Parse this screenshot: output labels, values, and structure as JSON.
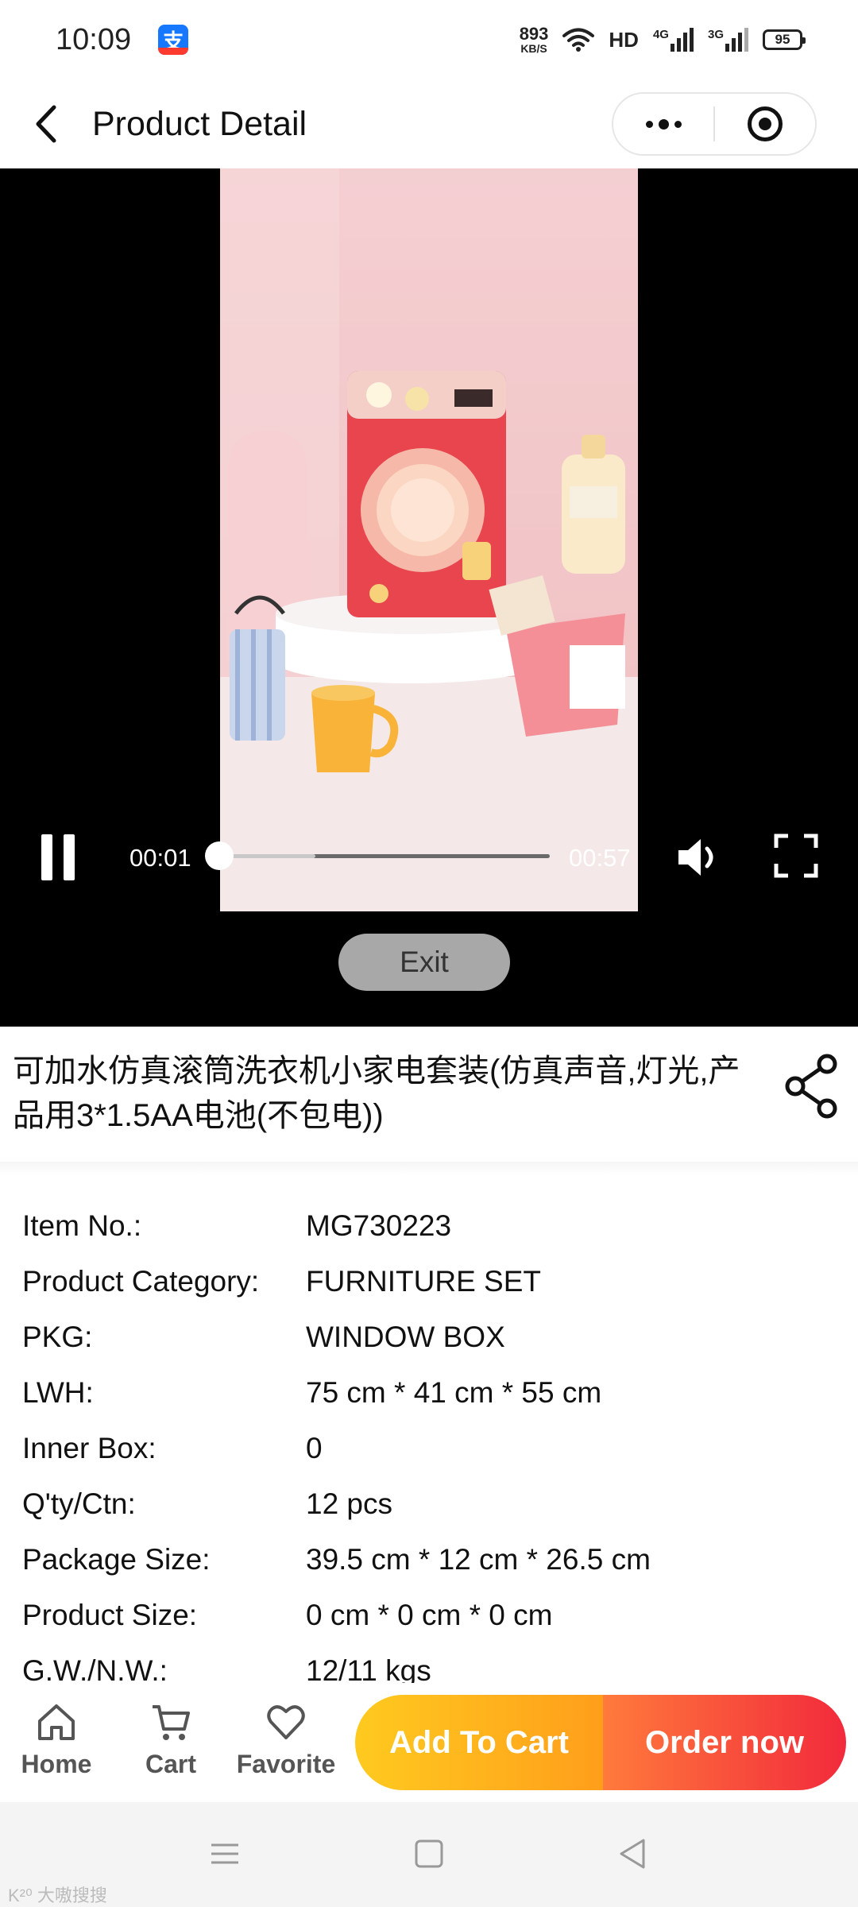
{
  "status_bar": {
    "time": "10:09",
    "app_icon": "alipay-icon",
    "alipay_glyph": "支",
    "net_speed_value": "893",
    "net_speed_unit": "KB/S",
    "hd_label": "HD",
    "sim1_label": "4G",
    "sim2_label": "3G",
    "battery": "95"
  },
  "nav": {
    "back_icon": "chevron-left-icon",
    "title": "Product Detail",
    "more_icon": "more-dots-icon",
    "target_icon": "target-icon"
  },
  "video": {
    "state": "playing",
    "current_time": "00:01",
    "total_time": "00:57",
    "progress_fraction": 0.0,
    "buffered_fraction": 0.29,
    "exit_label": "Exit"
  },
  "product": {
    "title": "可加水仿真滚筒洗衣机小家电套装(仿真声音,灯光,产品用3*1.5AA电池(不包电))",
    "share_icon": "share-icon",
    "specs": [
      {
        "label": "Item No.:",
        "value": "MG730223"
      },
      {
        "label": "Product Category:",
        "value": "FURNITURE SET"
      },
      {
        "label": "PKG:",
        "value": "WINDOW BOX"
      },
      {
        "label": "LWH:",
        "value": "75 cm * 41 cm * 55 cm"
      },
      {
        "label": "Inner Box:",
        "value": "0"
      },
      {
        "label": "Q'ty/Ctn:",
        "value": "12 pcs"
      },
      {
        "label": "Package Size:",
        "value": "39.5 cm * 12 cm * 26.5 cm"
      },
      {
        "label": "Product Size:",
        "value": "0 cm * 0 cm * 0 cm"
      },
      {
        "label": "G.W./N.W.:",
        "value": "12/11 kgs"
      }
    ]
  },
  "action_bar": {
    "home_label": "Home",
    "cart_label": "Cart",
    "favorite_label": "Favorite",
    "add_to_cart_label": "Add To Cart",
    "order_now_label": "Order now"
  },
  "colors": {
    "add_to_cart_start": "#ffca1f",
    "add_to_cart_end": "#ff9e1b",
    "order_now_start": "#ff7a3c",
    "order_now_end": "#f22a3c",
    "video_bg": "#000000",
    "tab_label": "#555555"
  },
  "watermark": "K²⁰ 大嗷搜搜"
}
